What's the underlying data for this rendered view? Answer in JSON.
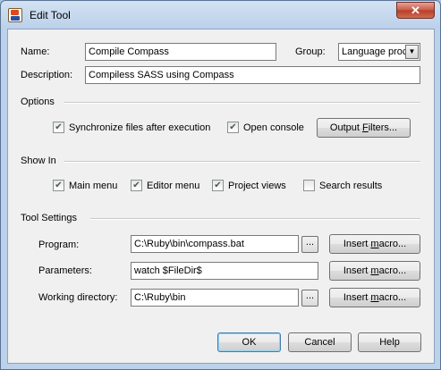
{
  "window": {
    "title": "Edit Tool",
    "close_glyph": "✕"
  },
  "fields": {
    "name_label": "Name:",
    "name_value": "Compile Compass",
    "group_label": "Group:",
    "group_value": "Language proc",
    "description_label": "Description:",
    "description_value": "Compiless SASS using Compass"
  },
  "options": {
    "section_label": "Options",
    "sync_label": "Synchronize files after execution",
    "sync_checked": true,
    "console_label": "Open console",
    "console_checked": true,
    "output_filters_label_pre": "Output ",
    "output_filters_label_ul": "F",
    "output_filters_label_post": "ilters..."
  },
  "show_in": {
    "section_label": "Show In",
    "items": [
      {
        "label": "Main menu",
        "checked": true
      },
      {
        "label": "Editor menu",
        "checked": true
      },
      {
        "label": "Project views",
        "checked": true
      },
      {
        "label": "Search results",
        "checked": false
      }
    ]
  },
  "tool_settings": {
    "section_label": "Tool Settings",
    "program_label": "Program:",
    "program_value": "C:\\Ruby\\bin\\compass.bat",
    "parameters_label": "Parameters:",
    "parameters_value": "watch $FileDir$",
    "workdir_label": "Working directory:",
    "workdir_value": "C:\\Ruby\\bin",
    "browse_label": "...",
    "insert_macro_label_pre": "Insert ",
    "insert_macro_label_ul": "m",
    "insert_macro_label_post": "acro..."
  },
  "buttons": {
    "ok": "OK",
    "cancel": "Cancel",
    "help": "Help"
  },
  "icons": {
    "check": "✔",
    "dropdown": "▼"
  }
}
